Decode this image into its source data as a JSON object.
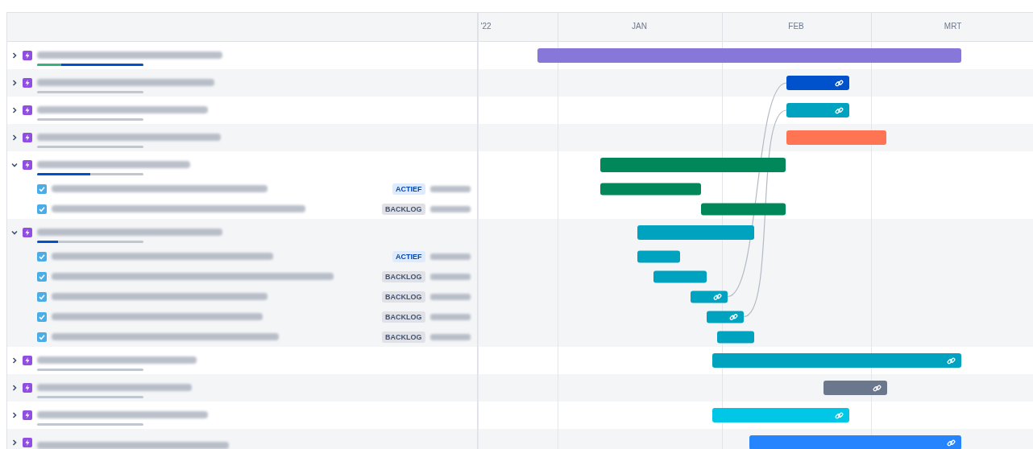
{
  "months": [
    {
      "label": "'22"
    },
    {
      "label": "JAN"
    },
    {
      "label": "FEB"
    },
    {
      "label": "MRT"
    }
  ],
  "epics": [
    {
      "expanded": false,
      "progress": {
        "done": {
          "level": 0.23
        },
        "in_progress": {
          "level": 0.77
        }
      },
      "bar": {
        "color": "#8777d9",
        "linked": false
      }
    },
    {
      "expanded": false,
      "progress": {
        "done": {
          "level": 0
        },
        "in_progress": {
          "level": 0
        }
      },
      "bar": {
        "color": "#0052cc",
        "linked": true
      }
    },
    {
      "expanded": false,
      "progress": {
        "done": {
          "level": 0
        },
        "in_progress": {
          "level": 0
        }
      },
      "bar": {
        "color": "#00a3bf",
        "linked": true
      }
    },
    {
      "expanded": false,
      "progress": {
        "done": {
          "level": 0
        },
        "in_progress": {
          "level": 0
        }
      },
      "bar": {
        "color": "#ff7452",
        "linked": false
      }
    },
    {
      "expanded": true,
      "progress": {
        "done": {
          "level": 0
        },
        "in_progress": {
          "level": 0.5
        }
      },
      "bar": {
        "color": "#00875a",
        "linked": false
      },
      "children": [
        {
          "status": {
            "label": "ACTIEF",
            "kind": "active"
          },
          "bar": {
            "color": "#00875a",
            "linked": false
          }
        },
        {
          "status": {
            "label": "BACKLOG",
            "kind": "backlog"
          },
          "bar": {
            "color": "#00875a",
            "linked": false
          }
        }
      ]
    },
    {
      "expanded": true,
      "progress": {
        "done": {
          "level": 0
        },
        "in_progress": {
          "level": 0.2
        }
      },
      "bar": {
        "color": "#00a3bf",
        "linked": false
      },
      "children": [
        {
          "status": {
            "label": "ACTIEF",
            "kind": "active"
          },
          "bar": {
            "color": "#00a3bf",
            "linked": false
          }
        },
        {
          "status": {
            "label": "BACKLOG",
            "kind": "backlog"
          },
          "bar": {
            "color": "#00a3bf",
            "linked": false
          }
        },
        {
          "status": {
            "label": "BACKLOG",
            "kind": "backlog"
          },
          "bar": {
            "color": "#00a3bf",
            "linked": true
          }
        },
        {
          "status": {
            "label": "BACKLOG",
            "kind": "backlog"
          },
          "bar": {
            "color": "#00a3bf",
            "linked": true
          }
        },
        {
          "status": {
            "label": "BACKLOG",
            "kind": "backlog"
          },
          "bar": {
            "color": "#00a3bf",
            "linked": false
          }
        }
      ]
    },
    {
      "expanded": false,
      "progress": {
        "done": {
          "level": 0
        },
        "in_progress": {
          "level": 0
        }
      },
      "bar": {
        "color": "#00a3bf",
        "linked": true
      }
    },
    {
      "expanded": false,
      "progress": {
        "done": {
          "level": 0
        },
        "in_progress": {
          "level": 0
        }
      },
      "bar": {
        "color": "#6b778c",
        "linked": true
      }
    },
    {
      "expanded": false,
      "progress": {
        "done": {
          "level": 0
        },
        "in_progress": {
          "level": 0
        }
      },
      "bar": {
        "color": "#00c7e6",
        "linked": true
      }
    },
    {
      "expanded": false,
      "bar": {
        "color": "#2684ff",
        "linked": true
      }
    }
  ]
}
